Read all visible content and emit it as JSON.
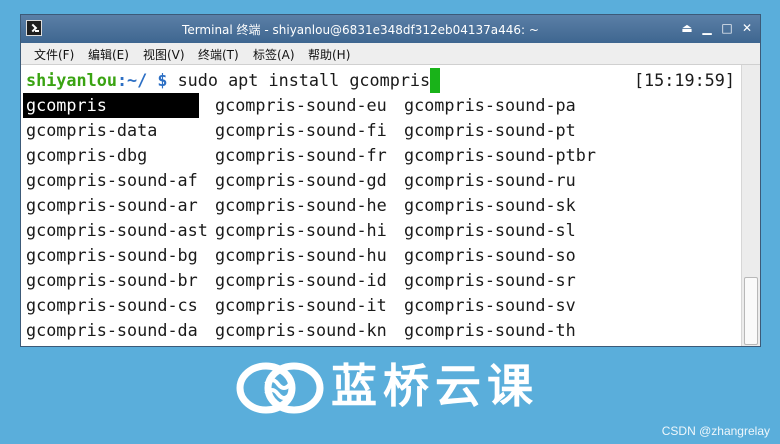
{
  "window": {
    "title": "Terminal 终端 - shiyanlou@6831e348df312eb04137a446: ~",
    "controls": [
      "⏏",
      "▁",
      "□",
      "✕"
    ]
  },
  "menubar": {
    "items": [
      "文件(F)",
      "编辑(E)",
      "视图(V)",
      "终端(T)",
      "标签(A)",
      "帮助(H)"
    ]
  },
  "terminal": {
    "prompt_user": "shiyanlou",
    "prompt_sep": ":~/ $ ",
    "command": "sudo apt install gcompris",
    "timestamp": "[15:19:59]",
    "completions": [
      [
        "gcompris",
        "gcompris-sound-eu",
        "gcompris-sound-pa"
      ],
      [
        "gcompris-data",
        "gcompris-sound-fi",
        "gcompris-sound-pt"
      ],
      [
        "gcompris-dbg",
        "gcompris-sound-fr",
        "gcompris-sound-ptbr"
      ],
      [
        "gcompris-sound-af",
        "gcompris-sound-gd",
        "gcompris-sound-ru"
      ],
      [
        "gcompris-sound-ar",
        "gcompris-sound-he",
        "gcompris-sound-sk"
      ],
      [
        "gcompris-sound-ast",
        "gcompris-sound-hi",
        "gcompris-sound-sl"
      ],
      [
        "gcompris-sound-bg",
        "gcompris-sound-hu",
        "gcompris-sound-so"
      ],
      [
        "gcompris-sound-br",
        "gcompris-sound-id",
        "gcompris-sound-sr"
      ],
      [
        "gcompris-sound-cs",
        "gcompris-sound-it",
        "gcompris-sound-sv"
      ],
      [
        "gcompris-sound-da",
        "gcompris-sound-kn",
        "gcompris-sound-th"
      ]
    ],
    "selected": "gcompris"
  },
  "branding": {
    "logo_text": "蓝桥云课",
    "watermark": "CSDN @zhangrelay"
  },
  "colors": {
    "background": "#5aaedb",
    "prompt_user": "#3aa312",
    "cursor": "#19b319",
    "titlebar": "#4a7099"
  }
}
